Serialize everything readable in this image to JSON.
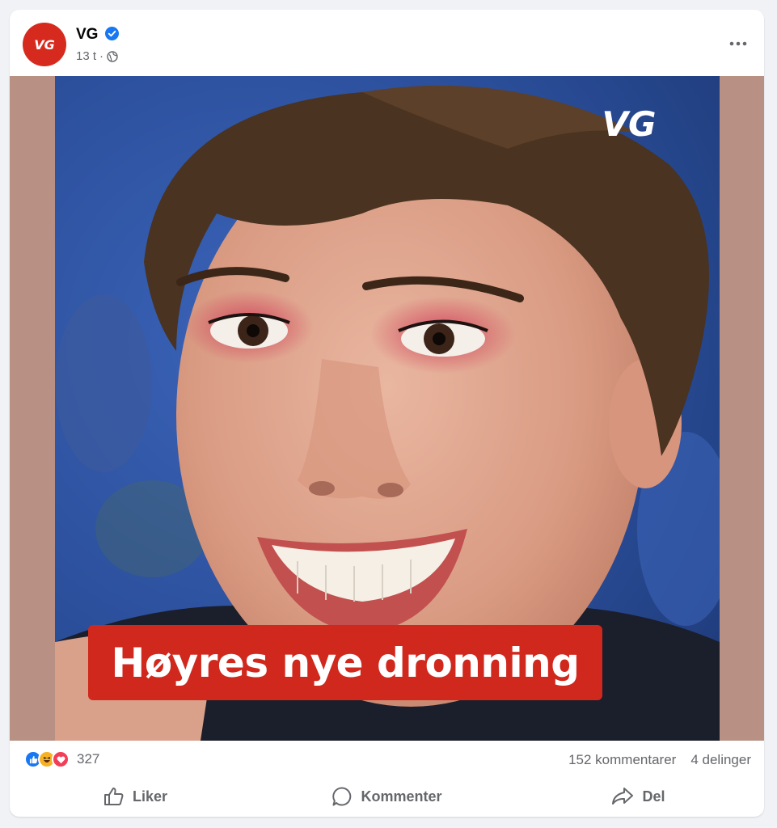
{
  "post": {
    "author": "VG",
    "avatar_text": "VG",
    "time": "13 t",
    "separator": "·",
    "caption": "Høyres nye dronning",
    "watermark": "VG"
  },
  "stats": {
    "reaction_count": "327",
    "comments": "152 kommentarer",
    "shares": "4 delinger"
  },
  "actions": {
    "like": "Liker",
    "comment": "Kommenter",
    "share": "Del"
  },
  "colors": {
    "brand_red": "#d72a1f",
    "like_blue": "#1877f2",
    "love_red": "#f33e58",
    "haha_yellow": "#f7b125"
  },
  "icons": [
    "vg-logo-icon",
    "verified-badge-icon",
    "globe-icon",
    "more-icon",
    "like-reaction-icon",
    "haha-reaction-icon",
    "love-reaction-icon",
    "thumbs-up-icon",
    "comment-icon",
    "share-icon"
  ]
}
